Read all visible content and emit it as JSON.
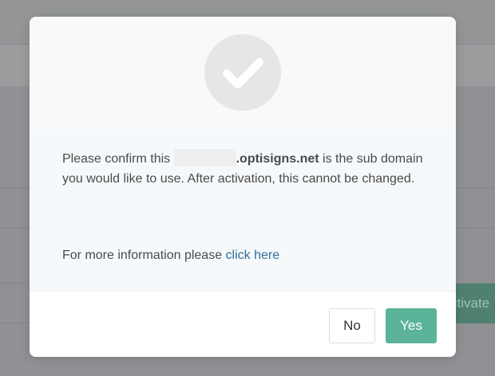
{
  "background": {
    "activate_button_label": "ctivate"
  },
  "dialog": {
    "icon": "checkmark-icon",
    "message": {
      "prefix": "Please confirm this ",
      "domain_suffix": ".optisigns.net",
      "rest": " is the sub domain you would like to use. After activation, this cannot be changed."
    },
    "more_info": {
      "text": "For more information please ",
      "link_label": "click here"
    },
    "buttons": {
      "no_label": "No",
      "yes_label": "Yes"
    }
  },
  "colors": {
    "accent": "#5bb39a",
    "link": "#2f6f9a",
    "overlay": "#8f9194"
  }
}
